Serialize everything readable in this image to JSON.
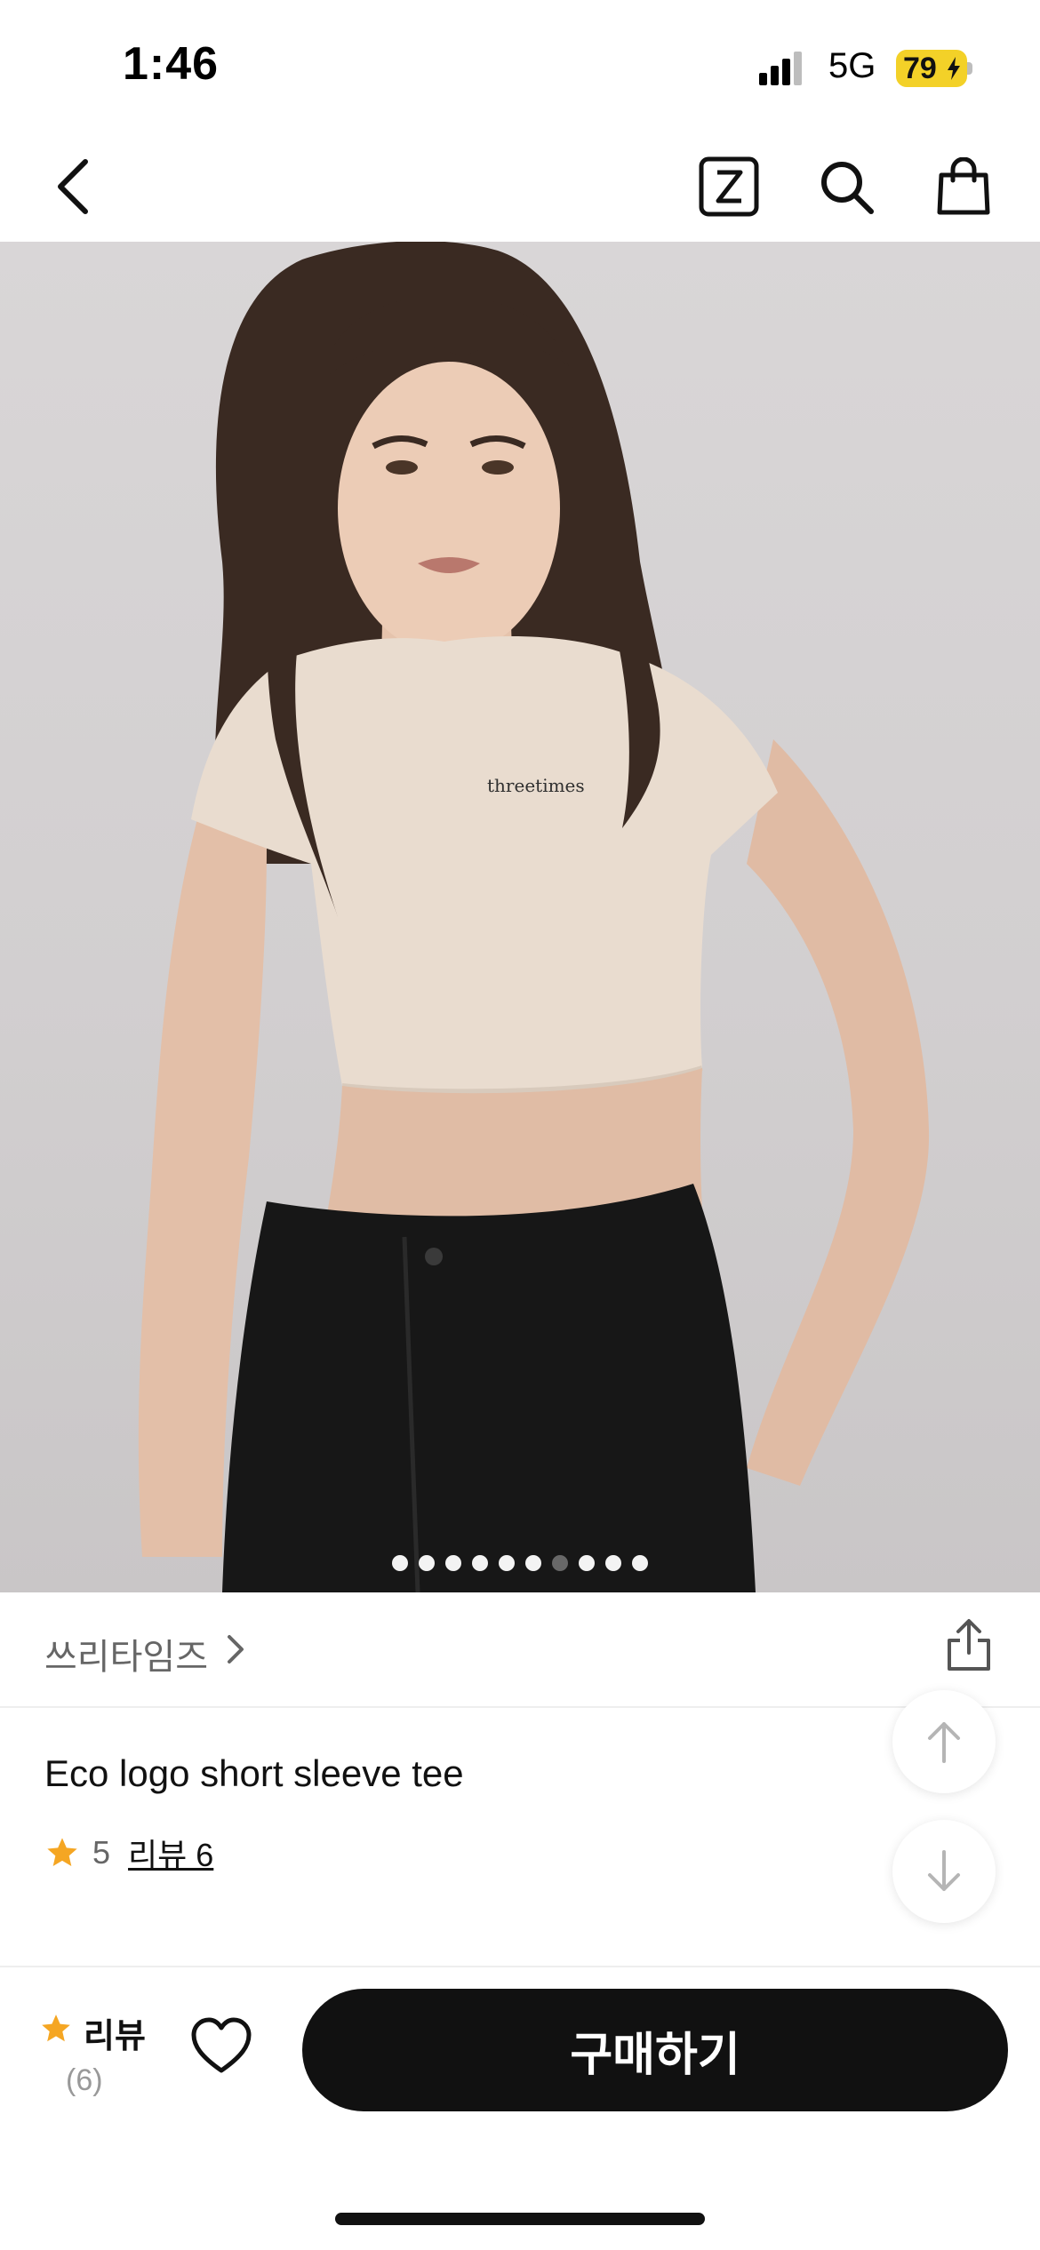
{
  "status_bar": {
    "time": "1:46",
    "network": "5G",
    "battery": "79"
  },
  "nav": {
    "icons": [
      "back-arrow-icon",
      "zigzag-z-icon",
      "search-icon",
      "shopping-bag-icon"
    ]
  },
  "hero": {
    "shirt_logo": "threetimes",
    "page_count": 10,
    "active_page": 7
  },
  "brand": {
    "name": "쓰리타임즈"
  },
  "product": {
    "title": "Eco logo short sleeve tee",
    "rating": "5",
    "review_link": "리뷰 6"
  },
  "bottom_bar": {
    "review_label": "리뷰",
    "review_count": "(6)",
    "buy_label": "구매하기"
  },
  "colors": {
    "star": "#f5a623",
    "buy_button": "#111111",
    "battery": "#f3d128"
  }
}
